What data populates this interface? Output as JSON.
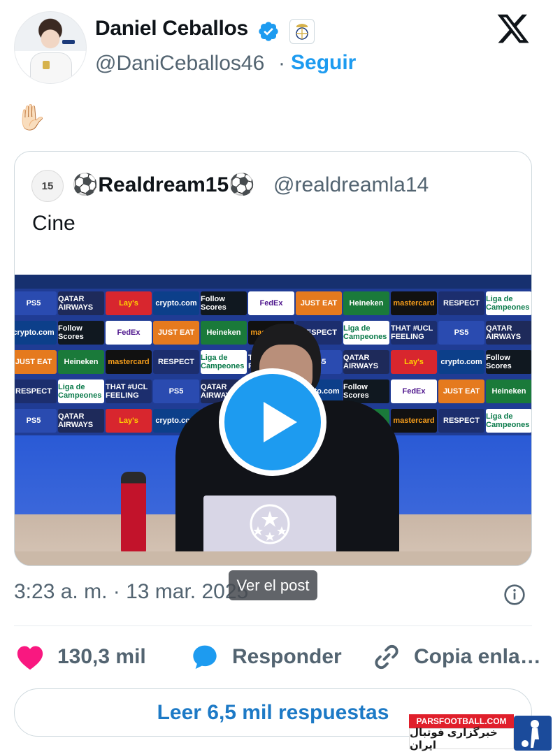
{
  "author": {
    "name": "Daniel Ceballos",
    "handle": "@DaniCeballos46",
    "follow_label": "Seguir"
  },
  "tweet": {
    "text": "✋🏻"
  },
  "quoted": {
    "avatar_text": "15",
    "name": "⚽Realdream15⚽",
    "handle": "@realdreamla14",
    "text": "Cine"
  },
  "video": {
    "sponsors": [
      "PS5",
      "QATAR AIRWAYS",
      "Lay's",
      "crypto.com",
      "Follow Scores",
      "FedEx",
      "JUST EAT",
      "Heineken",
      "mastercard",
      "RESPECT",
      "Liga de Campeones",
      "THAT #UCL FEELING"
    ]
  },
  "meta": {
    "timestamp": "3:23 a. m. · 13 mar. 2025",
    "tooltip": "Ver el post"
  },
  "actions": {
    "likes": "130,3 mil",
    "reply": "Responder",
    "copy": "Copia enla…"
  },
  "read_replies": "Leer 6,5 mil respuestas",
  "watermark": {
    "site": "PARSFOOTBALL.COM",
    "tagline": "خبرگزاری فوتبال ایران"
  },
  "colors": {
    "accent": "#1d9bf0",
    "like": "#f91880",
    "secondary_text": "#536471"
  }
}
